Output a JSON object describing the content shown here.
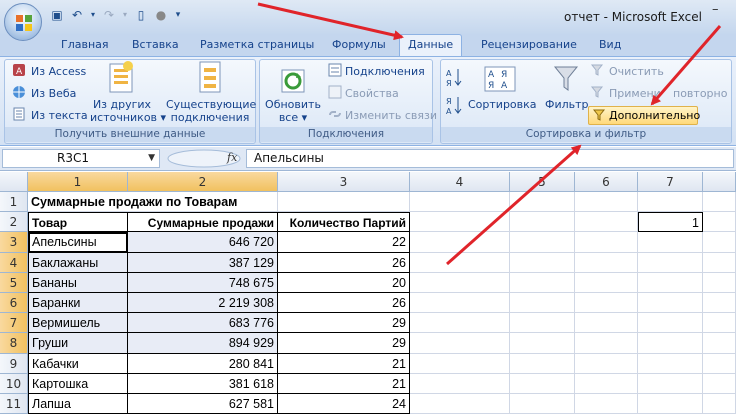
{
  "window": {
    "title": "отчет - Microsoft Excel",
    "minimize_glyph": "–"
  },
  "tabs": [
    "Главная",
    "Вставка",
    "Разметка страницы",
    "Формулы",
    "Данные",
    "Рецензирование",
    "Вид"
  ],
  "ribbon": {
    "external": {
      "from_access": "Из Access",
      "from_web": "Из Веба",
      "from_text": "Из текста",
      "from_other_1": "Из других",
      "from_other_2": "источников ▾",
      "existing_1": "Существующие",
      "existing_2": "подключения",
      "label": "Получить внешние данные"
    },
    "connections": {
      "refresh_1": "Обновить",
      "refresh_2": "все ▾",
      "connections": "Подключения",
      "properties": "Свойства",
      "edit_links": "Изменить связи",
      "label": "Подключения"
    },
    "sort": {
      "sort": "Сортировка",
      "filter": "Фильтр",
      "clear": "Очистить",
      "reapply_a": "Примени",
      "reapply_b": "повторно",
      "advanced": "Дополнительно",
      "label": "Сортировка и фильтр"
    }
  },
  "formula_bar": {
    "name": "R3C1",
    "fx": "fx",
    "value": "Апельсины"
  },
  "columns": [
    "1",
    "2",
    "3",
    "4",
    "5",
    "6",
    "7"
  ],
  "rows": [
    {
      "num": "1",
      "c1": "Суммарные продажи по Товарам",
      "c2": "",
      "c3": "",
      "c7": ""
    },
    {
      "num": "2",
      "c1": "Товар",
      "c2": "Суммарные продажи",
      "c3": "Количество Партий",
      "c7": "1"
    },
    {
      "num": "3",
      "c1": "Апельсины",
      "c2": "646 720",
      "c3": "22",
      "c7": ""
    },
    {
      "num": "4",
      "c1": "Баклажаны",
      "c2": "387 129",
      "c3": "26",
      "c7": ""
    },
    {
      "num": "5",
      "c1": "Бананы",
      "c2": "748 675",
      "c3": "20",
      "c7": ""
    },
    {
      "num": "6",
      "c1": "Баранки",
      "c2": "2 219 308",
      "c3": "26",
      "c7": ""
    },
    {
      "num": "7",
      "c1": "Вермишель",
      "c2": "683 776",
      "c3": "29",
      "c7": ""
    },
    {
      "num": "8",
      "c1": "Груши",
      "c2": "894 929",
      "c3": "29",
      "c7": ""
    },
    {
      "num": "9",
      "c1": "Кабачки",
      "c2": "280 841",
      "c3": "21",
      "c7": ""
    },
    {
      "num": "10",
      "c1": "Картошка",
      "c2": "381 618",
      "c3": "21",
      "c7": ""
    },
    {
      "num": "11",
      "c1": "Лапша",
      "c2": "627 581",
      "c3": "24",
      "c7": ""
    }
  ],
  "colors": {
    "arrow": "#e0242a",
    "ribbon": "#dbe7f6",
    "selected_header": "#f1c15f"
  }
}
